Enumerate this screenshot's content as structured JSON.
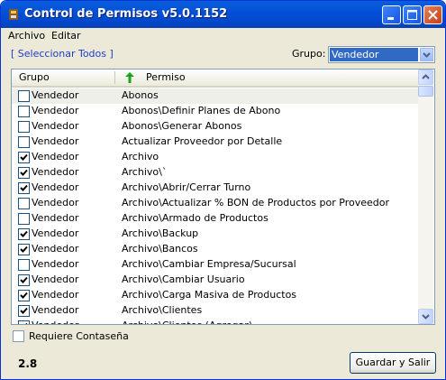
{
  "window": {
    "title": "Control de Permisos v5.0.1152"
  },
  "menu": {
    "items": [
      "Archivo",
      "Editar"
    ]
  },
  "toolbar": {
    "select_all": "[ Seleccionar Todos ]",
    "group_label": "Grupo:",
    "group_value": "Vendedor"
  },
  "list": {
    "columns": [
      "Grupo",
      "Permiso"
    ],
    "sort_icon": "sort-ascending-arrow-icon",
    "rows": [
      {
        "checked": false,
        "grupo": "Vendedor",
        "permiso": "Abonos"
      },
      {
        "checked": false,
        "grupo": "Vendedor",
        "permiso": "Abonos\\Definir Planes de Abono"
      },
      {
        "checked": false,
        "grupo": "Vendedor",
        "permiso": "Abonos\\Generar Abonos"
      },
      {
        "checked": false,
        "grupo": "Vendedor",
        "permiso": "Actualizar Proveedor por Detalle"
      },
      {
        "checked": true,
        "grupo": "Vendedor",
        "permiso": "Archivo"
      },
      {
        "checked": true,
        "grupo": "Vendedor",
        "permiso": "Archivo\\`"
      },
      {
        "checked": true,
        "grupo": "Vendedor",
        "permiso": "Archivo\\Abrir/Cerrar Turno"
      },
      {
        "checked": false,
        "grupo": "Vendedor",
        "permiso": "Archivo\\Actualizar % BON de Productos por Proveedor"
      },
      {
        "checked": false,
        "grupo": "Vendedor",
        "permiso": "Archivo\\Armado de Productos"
      },
      {
        "checked": true,
        "grupo": "Vendedor",
        "permiso": "Archivo\\Backup"
      },
      {
        "checked": true,
        "grupo": "Vendedor",
        "permiso": "Archivo\\Bancos"
      },
      {
        "checked": false,
        "grupo": "Vendedor",
        "permiso": "Archivo\\Cambiar Empresa/Sucursal"
      },
      {
        "checked": true,
        "grupo": "Vendedor",
        "permiso": "Archivo\\Cambiar Usuario"
      },
      {
        "checked": true,
        "grupo": "Vendedor",
        "permiso": "Archivo\\Carga Masiva de Productos"
      },
      {
        "checked": true,
        "grupo": "Vendedor",
        "permiso": "Archivo\\Clientes"
      },
      {
        "checked": true,
        "grupo": "Vendedor",
        "permiso": "Archivo\\Clientes (Agregar)"
      }
    ]
  },
  "footer": {
    "require_password_label": "Requiere Contaseña",
    "require_password_checked": false,
    "version": "2.8",
    "save_button": "Guardar y Salir"
  },
  "colors": {
    "title_bar": "#0450d8",
    "selection": "#316ac5",
    "link": "#1e3cc8",
    "window_bg": "#ece9d8"
  }
}
